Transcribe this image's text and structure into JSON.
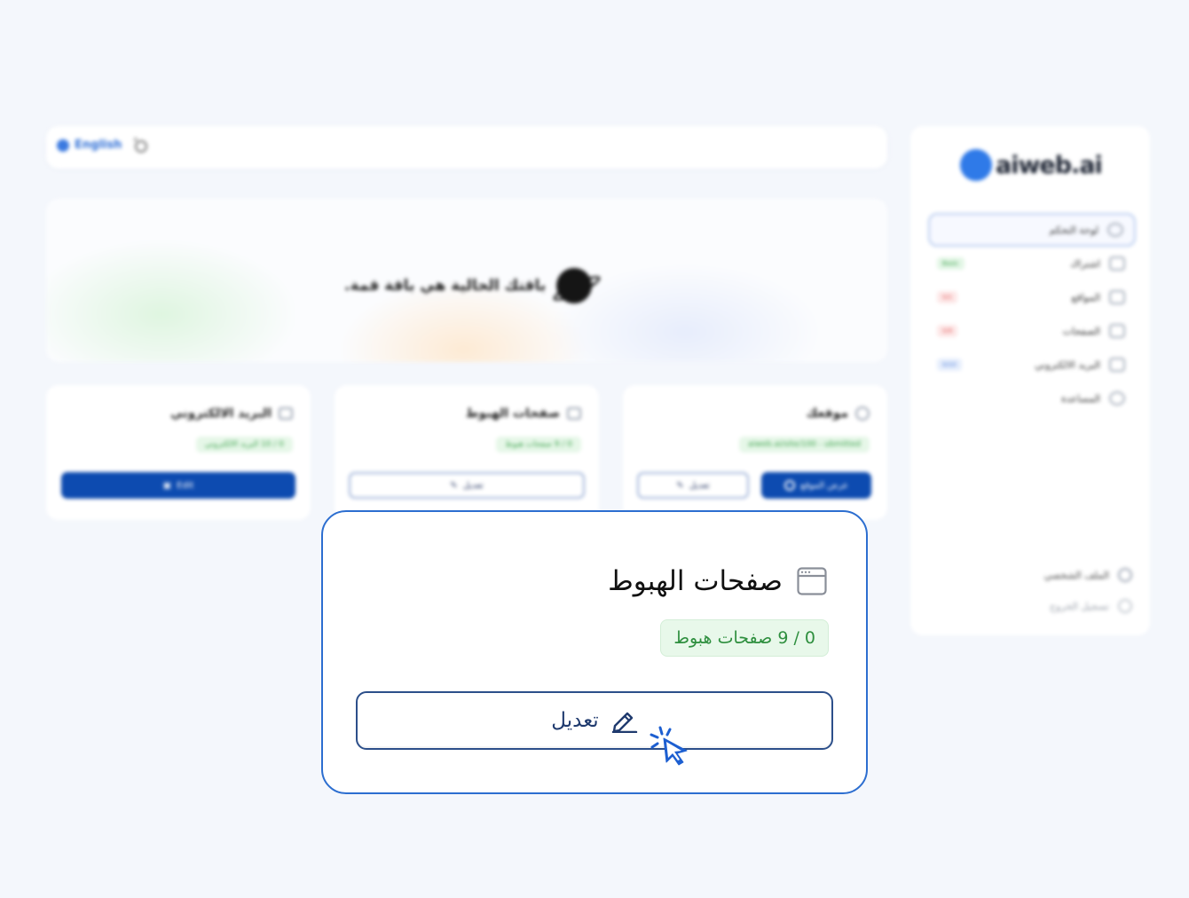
{
  "topbar": {
    "language_label": "English"
  },
  "banner": {
    "text": "باقتك الحالية هي باقة قمة."
  },
  "cards": [
    {
      "title": "موقعك",
      "badge": "aiweb.ai/site/100 - ubmitted",
      "primary_label": "عرض الموقع",
      "edit_label": "تعديل"
    },
    {
      "title": "صفحات الهبوط",
      "badge": "0 / 9 صفحات هبوط",
      "edit_label": "تعديل"
    },
    {
      "title": "البريد الالكتروني",
      "badge": "0 / 10 البريد الالكتروني",
      "primary_label": "Edit"
    }
  ],
  "sidebar": {
    "logo": "aiweb.ai",
    "items": [
      {
        "label": "لوحة التحكم",
        "icon": "home-icon"
      },
      {
        "label": "اشتراك",
        "icon": "card-icon",
        "pill": "Basic",
        "pill_color": "#3aa04a",
        "pill_bg": "#e3f6e6"
      },
      {
        "label": "المواقع",
        "icon": "site-icon",
        "pill": "0/1",
        "pill_color": "#e25a5a",
        "pill_bg": "#fde8e8"
      },
      {
        "label": "الصفحات",
        "icon": "page-icon",
        "pill": "0/9",
        "pill_color": "#e25a5a",
        "pill_bg": "#fde8e8"
      },
      {
        "label": "البريد الالكتروني",
        "icon": "mail-icon",
        "pill": "0/10",
        "pill_color": "#4a7ad8",
        "pill_bg": "#e6eefc"
      },
      {
        "label": "المساعدة",
        "icon": "help-icon"
      }
    ],
    "profile_label": "الملف الشخصي",
    "logout_label": "تسجيل الخروج"
  },
  "focus_card": {
    "title": "صفحات الهبوط",
    "badge": "0 / 9 صفحات هبوط",
    "edit_label": "تعديل"
  },
  "colors": {
    "primary": "#0d4bb0",
    "accent": "#2c6ed0",
    "badge_green": "#2e8f3e"
  }
}
